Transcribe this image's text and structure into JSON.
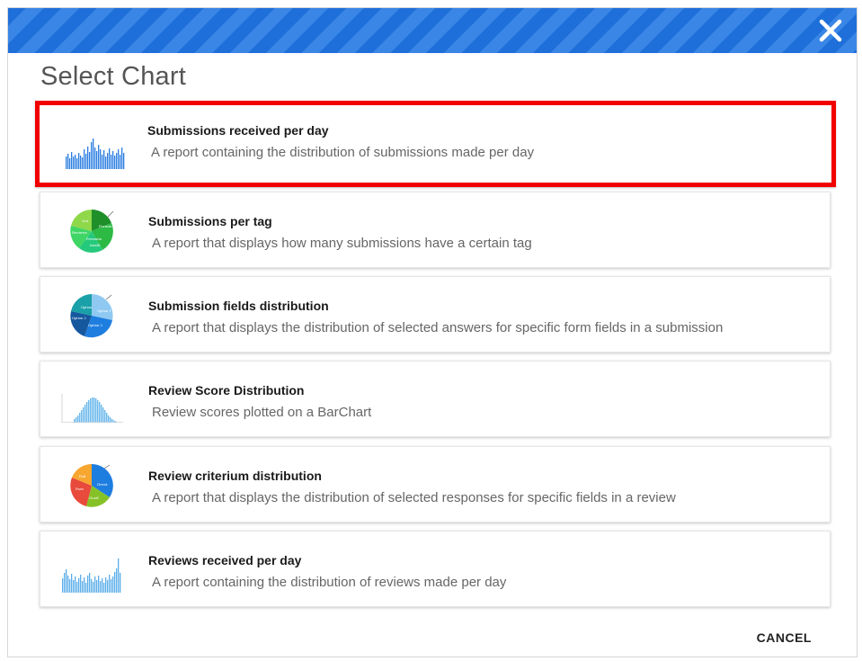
{
  "dialog": {
    "title": "Select Chart",
    "cancel_label": "CANCEL",
    "header_colors": [
      "#1e6fd9",
      "#3a86e6"
    ],
    "selection_color": "#f20000"
  },
  "charts": [
    {
      "name": "Submissions received per day",
      "description": "A report containing the distribution of submissions made per day",
      "icon": "bar-chart-icon",
      "selected": true
    },
    {
      "name": "Submissions per tag",
      "description": "A report that displays how many submissions have a certain tag",
      "icon": "pie-chart-icon",
      "pie_labels": [
        "Gut",
        "Formin",
        "Reviews",
        "Presentin",
        "Insulit"
      ],
      "selected": false
    },
    {
      "name": "Submission fields distribution",
      "description": "A report that displays the distribution of selected answers for specific form fields in a submission",
      "icon": "pie-chart-icon",
      "pie_labels": [
        "Option",
        "Option 1",
        "Option 2",
        "Option 3"
      ],
      "selected": false
    },
    {
      "name": "Review Score Distribution",
      "description": "Review scores plotted on a BarChart",
      "icon": "histogram-icon",
      "selected": false
    },
    {
      "name": "Review criterium distribution",
      "description": "A report that displays the distribution of selected responses for specific fields in a review",
      "icon": "pie-chart-icon",
      "pie_labels": [
        "Fail",
        "Pass",
        "Good",
        "Great"
      ],
      "selected": false
    },
    {
      "name": "Reviews received per day",
      "description": "A report containing the distribution of reviews made per day",
      "icon": "bar-chart-icon",
      "selected": false
    }
  ]
}
